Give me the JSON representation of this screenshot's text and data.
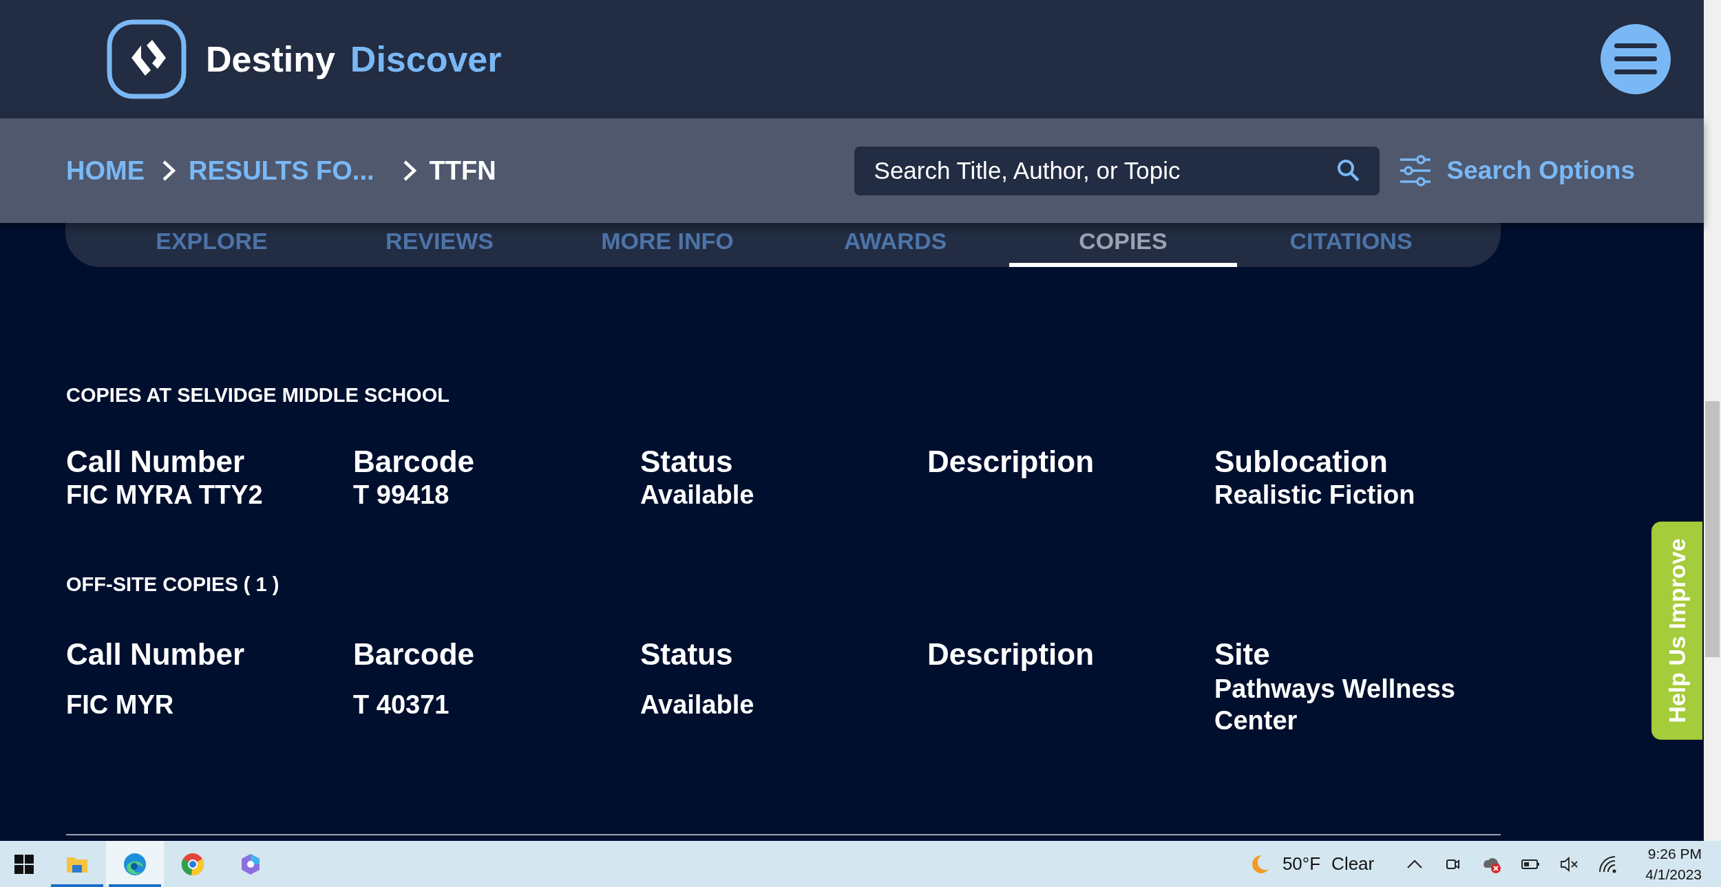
{
  "brand": {
    "name": "Destiny",
    "product": "Discover"
  },
  "breadcrumbs": [
    {
      "label": "HOME",
      "current": false
    },
    {
      "label": "RESULTS FO...",
      "current": false
    },
    {
      "label": "TTFN",
      "current": true
    }
  ],
  "search": {
    "placeholder": "Search Title, Author, or Topic"
  },
  "search_options": "Search Options",
  "tabs": [
    {
      "label": "EXPLORE",
      "selected": false
    },
    {
      "label": "REVIEWS",
      "selected": false
    },
    {
      "label": "MORE INFO",
      "selected": false
    },
    {
      "label": "AWARDS",
      "selected": false
    },
    {
      "label": "COPIES",
      "selected": true
    },
    {
      "label": "CITATIONS",
      "selected": false
    }
  ],
  "sections": [
    {
      "heading": "COPIES AT SELVIDGE MIDDLE SCHOOL",
      "columns": [
        {
          "header": "Call Number",
          "value": "FIC MYRA TTY2"
        },
        {
          "header": "Barcode",
          "value": "T 99418"
        },
        {
          "header": "Status",
          "value": "Available"
        },
        {
          "header": "Description"
        },
        {
          "header": "Sublocation",
          "value": "Realistic Fiction"
        }
      ]
    },
    {
      "heading": "OFF-SITE COPIES ( 1 )",
      "columns": [
        {
          "header": "Call Number",
          "value": "FIC MYR"
        },
        {
          "header": "Barcode",
          "value": "T 40371"
        },
        {
          "header": "Status",
          "value": "Available"
        },
        {
          "header": "Description"
        },
        {
          "header": "Site",
          "value": "Pathways Wellness Center"
        }
      ]
    }
  ],
  "feedback_tab": "Help Us Improve",
  "taskbar": {
    "apps": [
      {
        "kind": "files",
        "running": true,
        "selected": false
      },
      {
        "kind": "edge",
        "running": true,
        "selected": true
      },
      {
        "kind": "chrome",
        "running": false,
        "selected": false
      },
      {
        "kind": "copilot",
        "running": false,
        "selected": false
      }
    ],
    "weather": {
      "temperature": "50°F",
      "condition": "Clear"
    },
    "time": "9:26 PM",
    "date": "4/1/2023"
  }
}
